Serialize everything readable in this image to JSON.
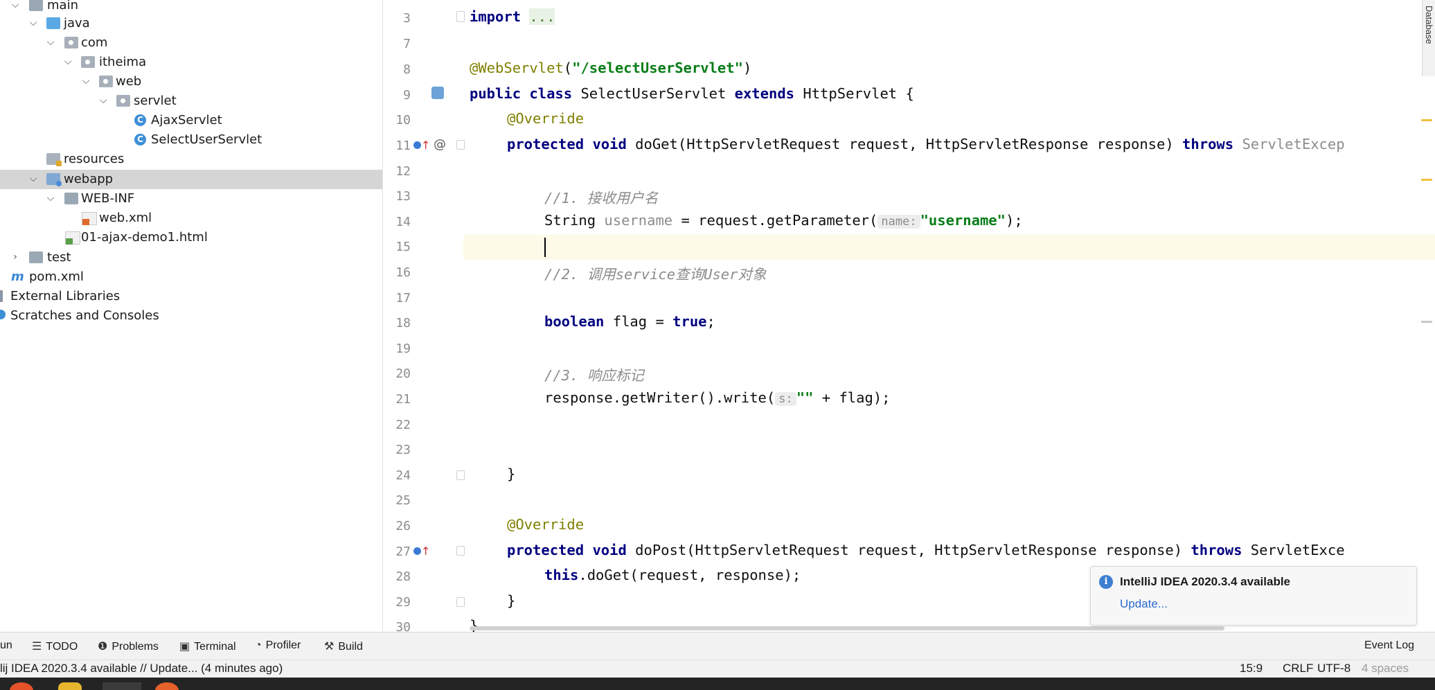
{
  "project_tree": {
    "items": [
      {
        "label": "main",
        "icon": "folder-icon"
      },
      {
        "label": "java",
        "icon": "source-folder-icon"
      },
      {
        "label": "com",
        "icon": "package-icon"
      },
      {
        "label": "itheima",
        "icon": "package-icon"
      },
      {
        "label": "web",
        "icon": "package-icon"
      },
      {
        "label": "servlet",
        "icon": "package-icon"
      },
      {
        "label": "AjaxServlet",
        "icon": "class-icon",
        "glyph": "C"
      },
      {
        "label": "SelectUserServlet",
        "icon": "class-icon",
        "glyph": "C"
      },
      {
        "label": "resources",
        "icon": "resources-folder-icon"
      },
      {
        "label": "webapp",
        "icon": "web-folder-icon"
      },
      {
        "label": "WEB-INF",
        "icon": "folder-icon"
      },
      {
        "label": "web.xml",
        "icon": "xml-file-icon"
      },
      {
        "label": "01-ajax-demo1.html",
        "icon": "html-file-icon"
      },
      {
        "label": "test",
        "icon": "folder-icon"
      },
      {
        "label": "pom.xml",
        "icon": "maven-file-icon",
        "glyph": "m"
      },
      {
        "label": "External Libraries",
        "icon": "libraries-icon"
      },
      {
        "label": "Scratches and Consoles",
        "icon": "scratches-icon"
      }
    ]
  },
  "editor": {
    "line_numbers": [
      "3",
      "7",
      "8",
      "9",
      "10",
      "11",
      "12",
      "13",
      "14",
      "15",
      "16",
      "17",
      "18",
      "19",
      "20",
      "21",
      "22",
      "23",
      "24",
      "25",
      "26",
      "27",
      "28",
      "29",
      "30"
    ],
    "code": {
      "l3_kw": "import",
      "l3_fold": "...",
      "l8_ann": "@WebServlet",
      "l8_open": "(",
      "l8_str": "\"/selectUserServlet\"",
      "l8_close": ")",
      "l9_kw1": "public",
      "l9_kw2": "class",
      "l9_name": " SelectUserServlet ",
      "l9_kw3": "extends",
      "l9_rest": " HttpServlet {",
      "l10_ann": "@Override",
      "l11_kw1": "protected",
      "l11_kw2": "void",
      "l11_rest": " doGet(HttpServletRequest request, HttpServletResponse response) ",
      "l11_kw3": "throws",
      "l11_exc": " ServletExcep",
      "l13_cmt": "//1. 接收用户名",
      "l14_type": "String ",
      "l14_var": "username",
      "l14_mid": " = request.getParameter(",
      "l14_hint": "name:",
      "l14_str": "\"username\"",
      "l14_end": ");",
      "l16_cmt": "//2. 调用service查询User对象",
      "l18_kw": "boolean",
      "l18_mid": " flag = ",
      "l18_val": "true",
      "l18_end": ";",
      "l20_cmt": "//3. 响应标记",
      "l21_start": "response.getWriter().write(",
      "l21_hint": "s:",
      "l21_str": "\"\"",
      "l21_end": " + flag);",
      "l24": "}",
      "l26_ann": "@Override",
      "l27_kw1": "protected",
      "l27_kw2": "void",
      "l27_rest": " doPost(HttpServletRequest request, HttpServletResponse response) ",
      "l27_kw3": "throws",
      "l27_exc": " ServletExce",
      "l28_kw": "this",
      "l28_rest": ".doGet(request, response);",
      "l29": "}",
      "l30": "}"
    },
    "gutter_icons": {
      "override_at": "@",
      "override_arrow": "↑"
    }
  },
  "notification": {
    "title": "IntelliJ IDEA 2020.3.4 available",
    "link": "Update..."
  },
  "tool_windows": [
    {
      "label": "un",
      "icon": ""
    },
    {
      "label": "TODO",
      "icon": "☰"
    },
    {
      "label": "Problems",
      "icon": "❶"
    },
    {
      "label": "Terminal",
      "icon": "▣"
    },
    {
      "label": "Profiler",
      "icon": "◔"
    },
    {
      "label": "Build",
      "icon": "⚒"
    },
    {
      "label": "Event Log",
      "icon": ""
    }
  ],
  "status_bar": {
    "message": "lij IDEA 2020.3.4 available // Update... (4 minutes ago)",
    "position": "15:9",
    "line_separator": "CRLF",
    "encoding": "UTF-8",
    "indent": "4 spaces"
  },
  "side_tab": {
    "label": "Database"
  },
  "colors": {
    "keyword": "#000080",
    "annotation": "#808000",
    "string": "#067d17",
    "comment": "#8c8c8c",
    "selection": "#d5d5d5",
    "caret_line": "#fdfae8",
    "link": "#2a6bd0"
  }
}
